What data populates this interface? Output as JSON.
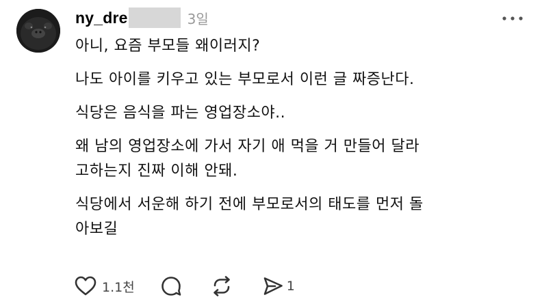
{
  "post": {
    "username": "ny_dre",
    "timestamp": "3일",
    "paragraphs": [
      "아니, 요즘 부모들 왜이러지?",
      "나도 아이를 키우고 있는 부모로서 이런 글 짜증난다.",
      "식당은 음식을 파는 영업장소야..",
      "왜 남의 영업장소에 가서 자기 애 먹을 거 만들어 달라\n고하는지 진짜 이해 안돼.",
      "식당에서 서운해 하기 전에 부모로서의 태도를 먼저 돌\n아보길"
    ]
  },
  "actions": {
    "like_count": "1.1천",
    "repost_count": "",
    "share_count": "1"
  },
  "icons": {
    "like": "heart-icon",
    "comment": "comment-bubble-icon",
    "repost": "repost-arrows-icon",
    "share": "send-icon",
    "more": "more-dots-icon"
  },
  "colors": {
    "text": "#000000",
    "muted": "#999999",
    "icon": "#333333",
    "redaction": "#d7d7d7"
  }
}
